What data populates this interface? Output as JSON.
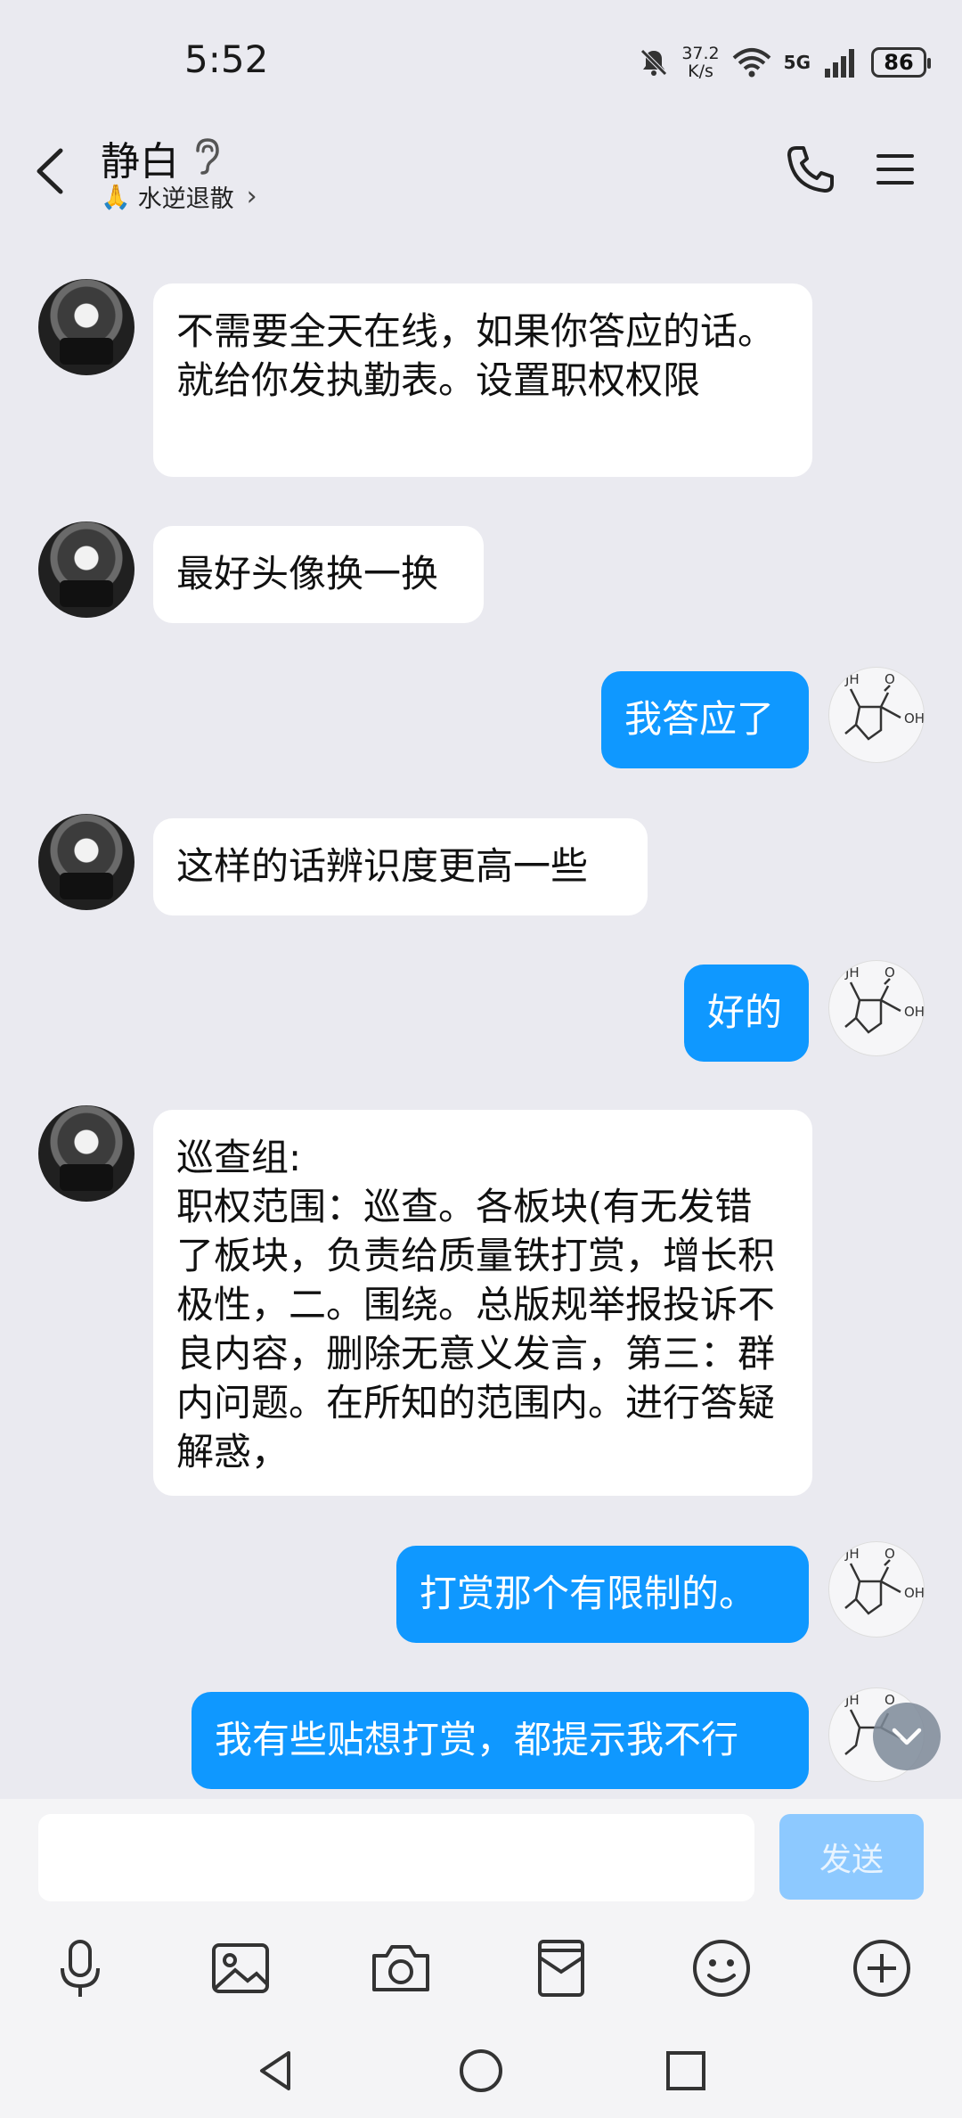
{
  "status_bar": {
    "time": "5:52",
    "speed_value": "37.2",
    "speed_unit": "K/s",
    "network": "5G",
    "battery": "86"
  },
  "header": {
    "title": "静白",
    "subtitle": "水逆退散"
  },
  "messages": [
    {
      "side": "in",
      "text": "不需要全天在线，如果你答应的话。就给你发执勤表。设置职权权限"
    },
    {
      "side": "in",
      "text": "最好头像换一换"
    },
    {
      "side": "out",
      "text": "我答应了"
    },
    {
      "side": "in",
      "text": "这样的话辨识度更高一些"
    },
    {
      "side": "out",
      "text": "好的"
    },
    {
      "side": "in",
      "text": "巡查组:\n职权范围：巡查。各板块(有无发错了板块，负责给质量铁打赏，增长积极性，二。围绕。总版规举报投诉不良内容，删除无意义发言，第三：群内问题。在所知的范围内。进行答疑解惑，"
    },
    {
      "side": "out",
      "text": "打赏那个有限制的。"
    },
    {
      "side": "out",
      "text": "我有些贴想打赏，都提示我不行"
    }
  ],
  "input": {
    "send_label": "发送",
    "placeholder": ""
  },
  "toolbar": [
    "mic-icon",
    "image-icon",
    "camera-icon",
    "red-packet-icon",
    "emoji-icon",
    "plus-icon"
  ],
  "colors": {
    "outgoing_bubble": "#0f98ff",
    "incoming_bubble": "#ffffff",
    "background": "#eaeaf0",
    "send_disabled": "#8dc9ff"
  }
}
